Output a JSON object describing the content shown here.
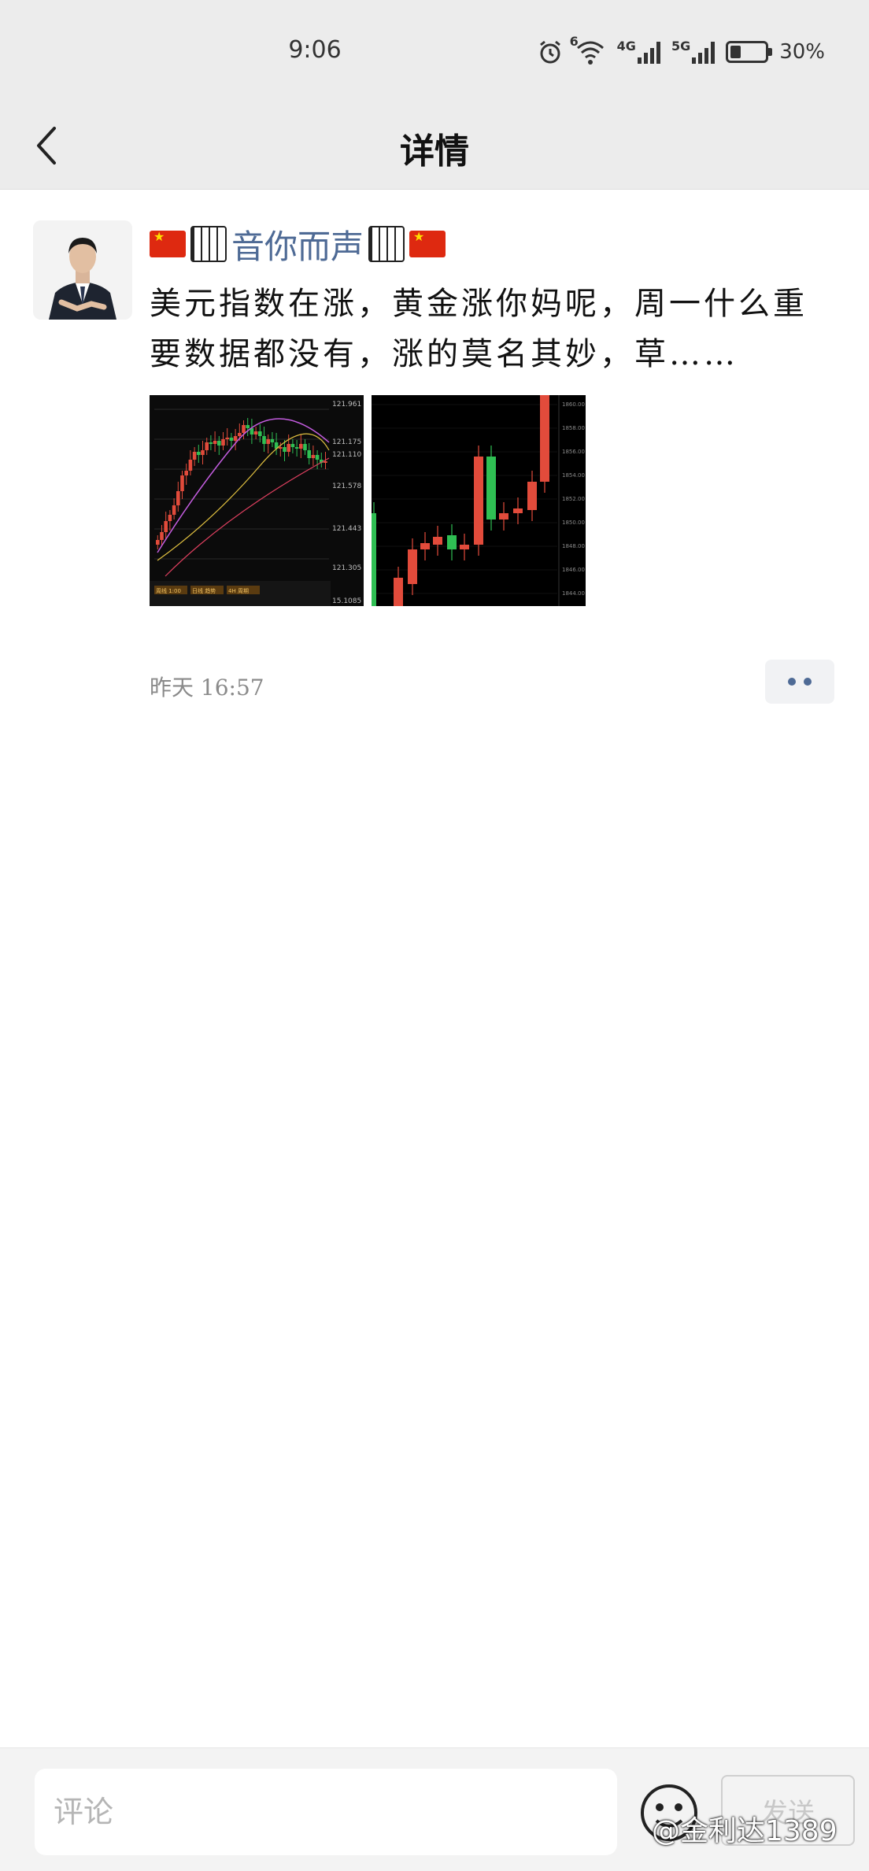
{
  "status_bar": {
    "time": "9:06",
    "net1": "4G",
    "net2": "5G",
    "wifi_label": "6",
    "battery_text": "30%",
    "battery_level": 0.3
  },
  "nav": {
    "title": "详情"
  },
  "post": {
    "nickname": "音你而声",
    "text": "美元指数在涨，黄金涨你妈呢，周一什么重要数据都没有，涨的莫名其妙，草……",
    "timestamp": "昨天 16:57"
  },
  "chart1": {
    "top_labels": [
      "121.961",
      "121.175",
      "121.110",
      "121.578",
      "121.443",
      "121.305",
      "15.1085"
    ],
    "bottom_chips": [
      "周线 1:00",
      "日线 趋势",
      "4H 周期"
    ]
  },
  "chart2": {
    "right_labels": [
      "1860.00",
      "1858.00",
      "1856.00",
      "1854.00",
      "1852.00",
      "1850.00",
      "1848.00",
      "1846.00",
      "1844.00"
    ]
  },
  "bottom_bar": {
    "comment_placeholder": "评论",
    "send_label": "发送",
    "watermark": "@金利达1389"
  }
}
